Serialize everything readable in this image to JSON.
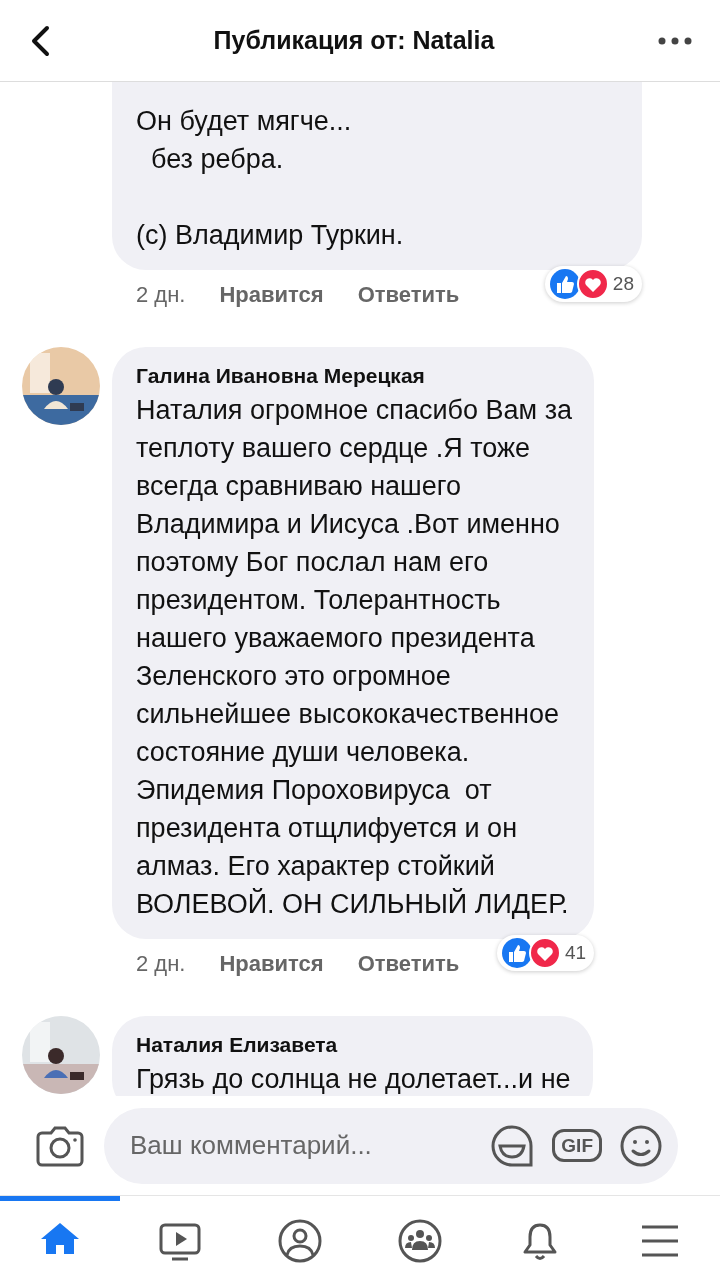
{
  "header": {
    "title": "Публикация от: Natalia"
  },
  "comments": [
    {
      "text": "Он будет мягче...\n  без ребра.\n\n(с) Владимир Туркин.",
      "time": "2 дн.",
      "like": "Нравится",
      "reply": "Ответить",
      "reactions": "28"
    },
    {
      "author": "Галина Ивановна Мерецкая",
      "text": "Наталия огромное спасибо Вам за\nтеплоту вашего сердце .Я тоже\nвсегда сравниваю нашего\nВладимира и Иисуса .Вот именно\nпоэтому Бог послал нам его\nпрезидентом. Толерантность\nнашего уважаемого президента\nЗеленского это огромное\nсильнейшее высококачественное\nсостояние души человека.\nЭпидемия Пороховируса  от\nпрезидента отщлифуется и он\nалмаз. Его характер стойкий\nВОЛЕВОЙ. ОН СИЛЬНЫЙ ЛИДЕР.",
      "time": "2 дн.",
      "like": "Нравится",
      "reply": "Ответить",
      "reactions": "41"
    },
    {
      "author": "Наталия Елизавета",
      "text": "Грязь до солнца не долетает...и не"
    }
  ],
  "comment_box": {
    "placeholder": "Ваш комментарий...",
    "gif_label": "GIF"
  },
  "tabs": [
    {
      "kind": "home",
      "selected": true
    },
    {
      "kind": "video",
      "selected": false
    },
    {
      "kind": "profile",
      "selected": false
    },
    {
      "kind": "groups",
      "selected": false
    },
    {
      "kind": "bell",
      "selected": false
    },
    {
      "kind": "menu",
      "selected": false
    }
  ]
}
